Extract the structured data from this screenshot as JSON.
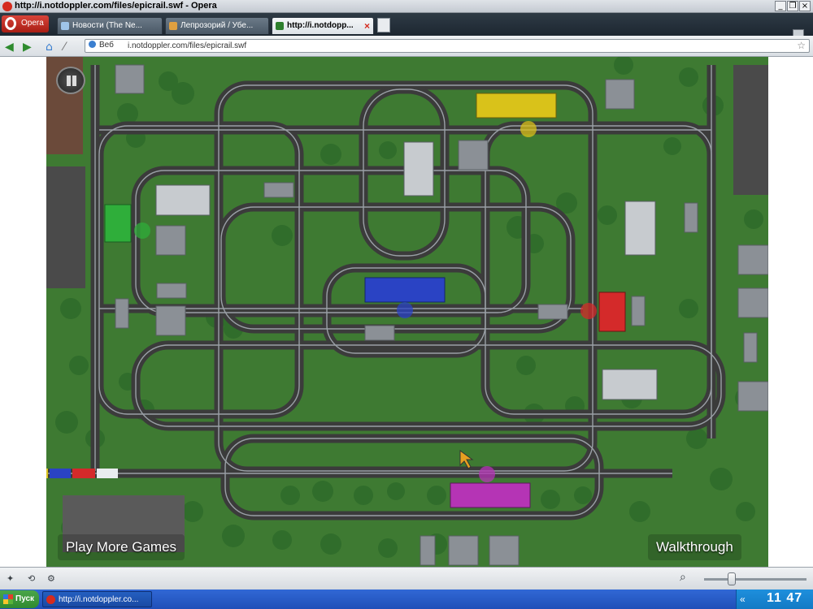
{
  "window": {
    "title": "http://i.notdoppler.com/files/epicrail.swf - Opera"
  },
  "menu": {
    "opera_label": "Opera"
  },
  "tabs": [
    {
      "label": "Новости (The Ne..."
    },
    {
      "label": "Лепрозорий / Убе..."
    },
    {
      "label": "http://i.notdopp..."
    }
  ],
  "address": {
    "search_engine": "Веб",
    "url": "i.notdoppler.com/files/epicrail.swf"
  },
  "game": {
    "play_more_label": "Play More Games",
    "walkthrough_label": "Walkthrough",
    "colors": {
      "grass": "#3e7a32",
      "yellow": "#d9c21a",
      "green": "#2fae3a",
      "blue": "#2a43c4",
      "red": "#d42a2a",
      "purple": "#b534b5"
    }
  },
  "taskbar": {
    "start_label": "Пуск",
    "task_label": "http://i.notdoppler.co...",
    "clock": "11 47"
  }
}
